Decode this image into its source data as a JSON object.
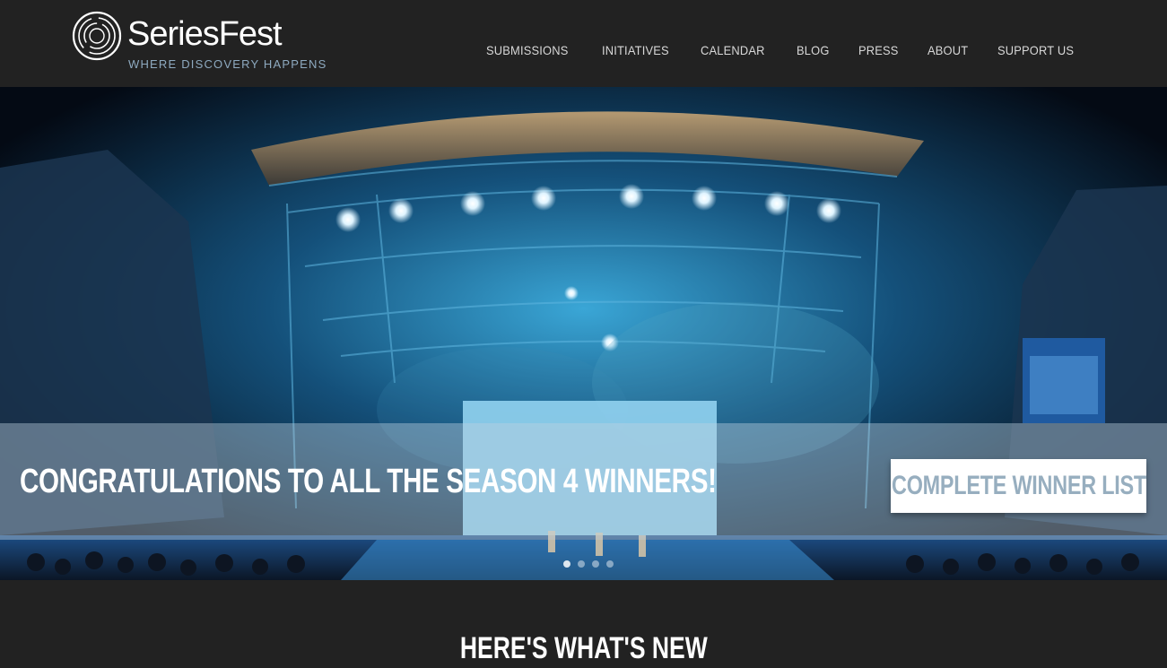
{
  "header": {
    "logo_name": "SeriesFest",
    "logo_tagline": "WHERE DISCOVERY HAPPENS"
  },
  "nav": {
    "items": [
      "SUBMISSIONS",
      "INITIATIVES",
      "CALENDAR",
      "BLOG",
      "PRESS",
      "ABOUT",
      "SUPPORT US"
    ]
  },
  "hero": {
    "headline": "CONGRATULATIONS TO ALL THE SEASON 4 WINNERS!",
    "cta_label": "COMPLETE WINNER LIST",
    "slide_count": 4,
    "active_slide": 1
  },
  "section": {
    "title": "HERE'S WHAT'S NEW"
  },
  "colors": {
    "background": "#222222",
    "accent": "#97aebf",
    "tagline": "#8eaac0"
  },
  "icons": {
    "logo": "concentric-circles-logo-icon"
  }
}
